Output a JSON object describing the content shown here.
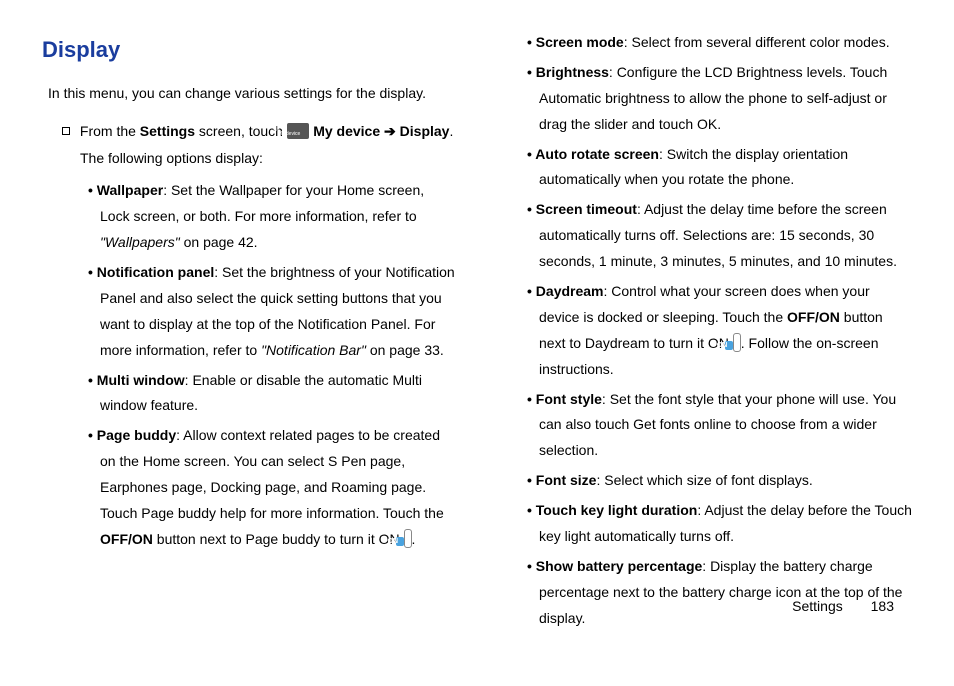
{
  "title": "Display",
  "intro": "In this menu, you can change various settings for the display.",
  "step_prefix": "From the ",
  "step_settings": "Settings",
  "step_mid": " screen, touch ",
  "icon_label": "My device",
  "step_mydevice": "My device",
  "arrow": "➔",
  "step_display": "Display",
  "step_period": ".",
  "following": "The following options display:",
  "left": [
    {
      "title": "Wallpaper",
      "body": ": Set the Wallpaper for your Home screen, Lock screen, or both. For more information, refer to ",
      "ref": "\"Wallpapers\"",
      "tail": " on page 42."
    },
    {
      "title": "Notification panel",
      "body": ": Set the brightness of your Notification Panel and also select the quick setting buttons that you want to display at the top of the Notification Panel. For more information, refer to ",
      "ref": "\"Notification Bar\"",
      "tail": " on page 33."
    },
    {
      "title": "Multi window",
      "body": ": Enable or disable the automatic Multi window feature."
    },
    {
      "title": "Page buddy",
      "body": ": Allow context related pages to be created on the Home screen. You can select S Pen page, Earphones page, Docking page, and Roaming page. Touch Page buddy help for more information. Touch the ",
      "bold2": "OFF/ON",
      "body2": " button next to Page buddy to turn it ON ",
      "on": true,
      "tail": "."
    }
  ],
  "right": [
    {
      "title": "Screen mode",
      "body": ": Select from several different color modes."
    },
    {
      "title": "Brightness",
      "body": ": Configure the LCD Brightness levels. Touch Automatic brightness to allow the phone to self-adjust or drag the slider and touch OK."
    },
    {
      "title": "Auto rotate screen",
      "body": ": Switch the display orientation automatically when you rotate the phone."
    },
    {
      "title": "Screen timeout",
      "body": ": Adjust the delay time before the screen automatically turns off. Selections are: 15 seconds, 30 seconds, 1 minute, 3 minutes, 5 minutes, and 10 minutes."
    },
    {
      "title": "Daydream",
      "body": ": Control what your screen does when your device is docked or sleeping. Touch the ",
      "bold2": "OFF/ON",
      "body2": " button next to Daydream to turn it ON ",
      "on": true,
      "tail": ". Follow the on-screen instructions."
    },
    {
      "title": "Font style",
      "body": ": Set the font style that your phone will use. You can also touch Get fonts online to choose from a wider selection."
    },
    {
      "title": "Font size",
      "body": ": Select which size of font displays."
    },
    {
      "title": "Touch key light duration",
      "body": ": Adjust the delay before the Touch key light automatically turns off."
    },
    {
      "title": "Show battery percentage",
      "body": ": Display the battery charge percentage next to the battery charge icon at the top of the display."
    }
  ],
  "footer_section": "Settings",
  "footer_page": "183",
  "on_label": "ON"
}
